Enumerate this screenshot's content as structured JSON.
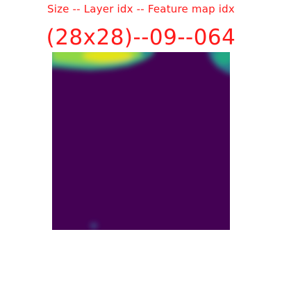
{
  "header": {
    "subtitle": "Size -- Layer idx -- Feature map idx",
    "title": "(28x28)--09--064"
  },
  "colors": {
    "text": "#ff1a1a",
    "background": "#ffffff",
    "colormap": "viridis"
  },
  "feature_map": {
    "size": "28x28",
    "layer_idx": "09",
    "feature_map_idx": "064",
    "description_of_activation": "mostly near-zero (dark purple) with high activations along the top-left edge and a small teal patch at top-right",
    "high_activation_regions": [
      {
        "name": "top-left band",
        "level": "high (green to yellow)"
      },
      {
        "name": "top-right corner",
        "level": "medium (teal)"
      },
      {
        "name": "bottom-center speck",
        "level": "low (faint blue-purple)"
      }
    ]
  }
}
